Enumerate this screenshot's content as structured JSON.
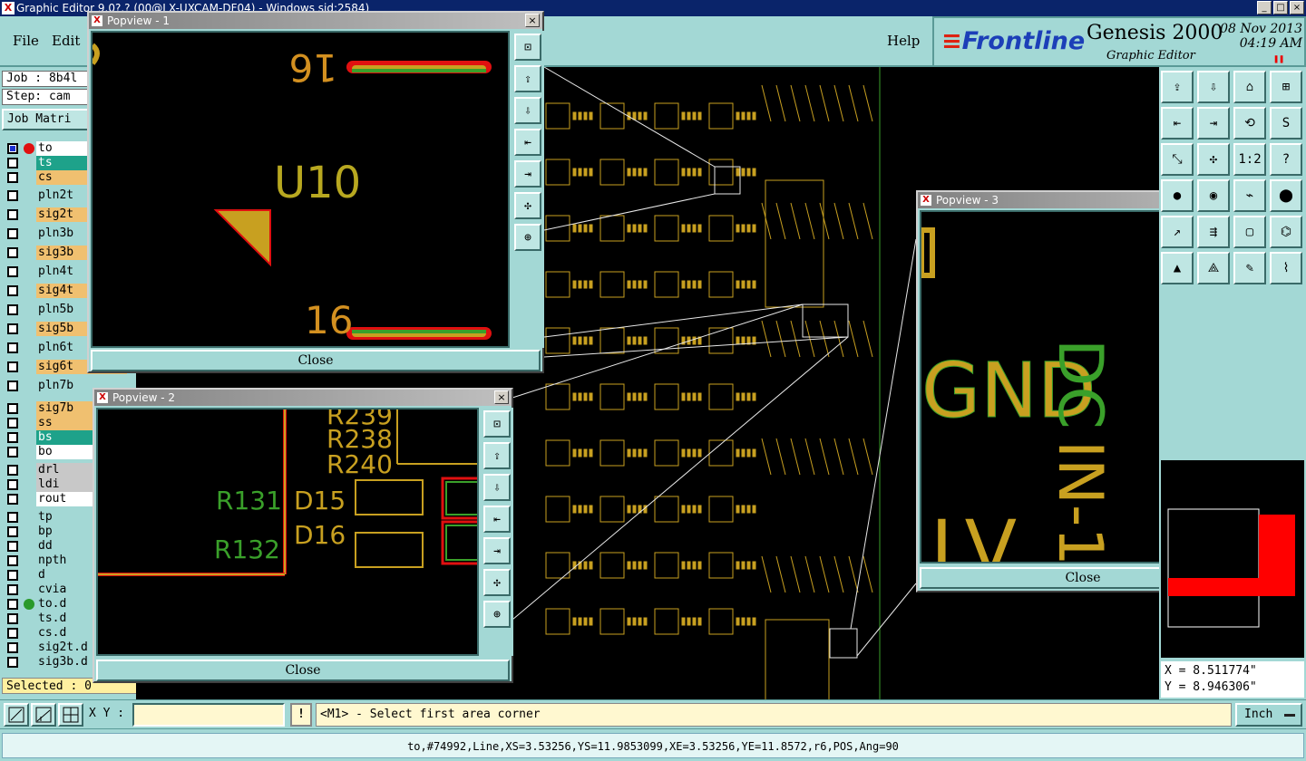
{
  "window": {
    "title": "Graphic Editor 9.0?.? (00@LX-UXCAM-DF04) - Windows sid:2584)"
  },
  "menu": {
    "file": "File",
    "edit": "Edit",
    "help": "Help"
  },
  "brand": {
    "logo": "Frontline",
    "product": "Genesis 2000",
    "subtitle": "Graphic Editor",
    "date": "08 Nov 2013",
    "time": "04:19 AM"
  },
  "job": {
    "job_label": "Job : 8b4l",
    "step_label": "Step: cam",
    "matrix_button": "Job Matri"
  },
  "layers": [
    {
      "name": "to",
      "bg": "#ffffff",
      "checked": true,
      "dot": "#e01010"
    },
    {
      "name": "ts",
      "bg": "#1ea28a",
      "checked": false,
      "dot": ""
    },
    {
      "name": "cs",
      "bg": "#f0c070",
      "checked": false,
      "dot": ""
    },
    {
      "name": "pln2t",
      "bg": "#a3d8d5",
      "checked": false,
      "dot": ""
    },
    {
      "name": "sig2t",
      "bg": "#f0c070",
      "checked": false,
      "dot": ""
    },
    {
      "name": "pln3b",
      "bg": "#a3d8d5",
      "checked": false,
      "dot": ""
    },
    {
      "name": "sig3b",
      "bg": "#f0c070",
      "checked": false,
      "dot": ""
    },
    {
      "name": "pln4t",
      "bg": "#a3d8d5",
      "checked": false,
      "dot": ""
    },
    {
      "name": "sig4t",
      "bg": "#f0c070",
      "checked": false,
      "dot": ""
    },
    {
      "name": "pln5b",
      "bg": "#a3d8d5",
      "checked": false,
      "dot": ""
    },
    {
      "name": "sig5b",
      "bg": "#f0c070",
      "checked": false,
      "dot": ""
    },
    {
      "name": "pln6t",
      "bg": "#a3d8d5",
      "checked": false,
      "dot": ""
    },
    {
      "name": "sig6t",
      "bg": "#f0c070",
      "checked": false,
      "dot": ""
    },
    {
      "name": "pln7b",
      "bg": "#a3d8d5",
      "checked": false,
      "dot": ""
    },
    {
      "name": "sig7b",
      "bg": "#f0c070",
      "checked": false,
      "dot": ""
    },
    {
      "name": "ss",
      "bg": "#f0c070",
      "checked": false,
      "dot": ""
    },
    {
      "name": "bs",
      "bg": "#1ea28a",
      "checked": false,
      "dot": ""
    },
    {
      "name": "bo",
      "bg": "#ffffff",
      "checked": false,
      "dot": ""
    },
    {
      "name": "drl",
      "bg": "#c8c8c8",
      "checked": false,
      "dot": ""
    },
    {
      "name": "ldi",
      "bg": "#c8c8c8",
      "checked": false,
      "dot": ""
    },
    {
      "name": "rout",
      "bg": "#ffffff",
      "checked": false,
      "dot": ""
    },
    {
      "name": "tp",
      "bg": "#a3d8d5",
      "checked": false,
      "dot": ""
    },
    {
      "name": "bp",
      "bg": "#a3d8d5",
      "checked": false,
      "dot": ""
    },
    {
      "name": "dd",
      "bg": "#a3d8d5",
      "checked": false,
      "dot": ""
    },
    {
      "name": "npth",
      "bg": "#a3d8d5",
      "checked": false,
      "dot": ""
    },
    {
      "name": "d",
      "bg": "#a3d8d5",
      "checked": false,
      "dot": ""
    },
    {
      "name": "cvia",
      "bg": "#a3d8d5",
      "checked": false,
      "dot": ""
    },
    {
      "name": "to.d",
      "bg": "#a3d8d5",
      "checked": false,
      "dot": "#2a9a2a"
    },
    {
      "name": "ts.d",
      "bg": "#a3d8d5",
      "checked": false,
      "dot": ""
    },
    {
      "name": "cs.d",
      "bg": "#a3d8d5",
      "checked": false,
      "dot": ""
    },
    {
      "name": "sig2t.d",
      "bg": "#a3d8d5",
      "checked": false,
      "dot": ""
    },
    {
      "name": "sig3b.d",
      "bg": "#a3d8d5",
      "checked": false,
      "dot": ""
    }
  ],
  "selected": "Selected : 0",
  "popviews": [
    {
      "title": "Popview - 1",
      "close": "Close"
    },
    {
      "title": "Popview - 2",
      "close": "Close"
    },
    {
      "title": "Popview - 3",
      "close": "Close"
    }
  ],
  "popview1_labels": {
    "top": "16",
    "center": "U10",
    "bottom": "16"
  },
  "popview2_labels": {
    "r239": "R239",
    "r238": "R238",
    "r240": "R240",
    "r131": "R131",
    "d15": "D15",
    "r132": "R132",
    "d16": "D16"
  },
  "popview3_labels": {
    "gnd": "GND",
    "dc": "DC",
    "in": "IN-1",
    "lv": "LV"
  },
  "right_tool_labels": {
    "ratio": "1:2",
    "help": "?"
  },
  "coords": {
    "x": "X = 8.511774\"",
    "y": "Y = 8.946306\""
  },
  "command": {
    "xy_label": "X Y :",
    "xy_value": "",
    "prompt": "<M1> - Select first area corner",
    "units": "Inch",
    "bang": "!"
  },
  "status": "to,#74992,Line,XS=3.53256,YS=11.9853099,XE=3.53256,YE=11.8572,r6,POS,Ang=90",
  "colors": {
    "panel": "#a3d8d5",
    "trace": "#c8a020",
    "green": "#3aa02a",
    "red": "#e01010"
  }
}
